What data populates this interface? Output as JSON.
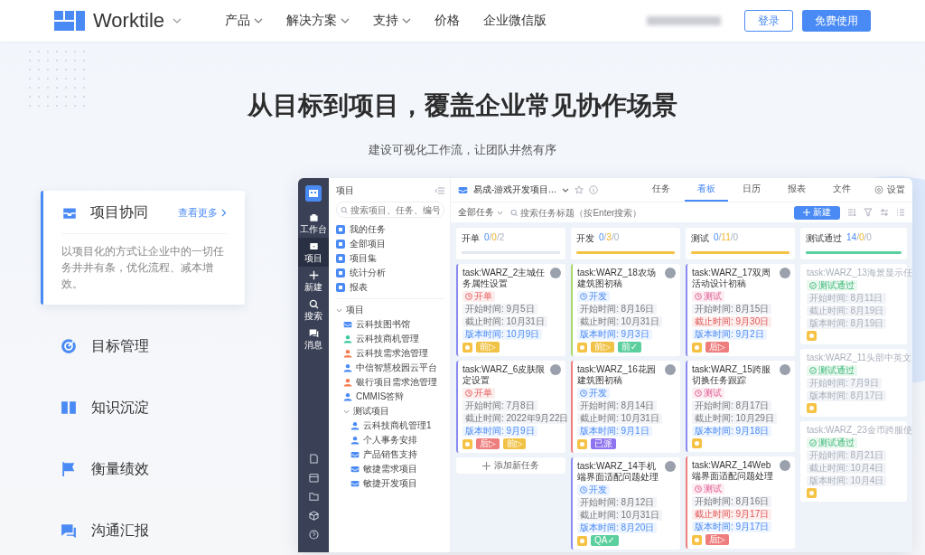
{
  "nav": {
    "logo": "Worktile",
    "items": [
      {
        "label": "产品",
        "dropdown": true
      },
      {
        "label": "解决方案",
        "dropdown": true
      },
      {
        "label": "支持",
        "dropdown": true
      },
      {
        "label": "价格",
        "dropdown": false
      },
      {
        "label": "企业微信版",
        "dropdown": false
      }
    ],
    "login": "登录",
    "signup": "免费使用"
  },
  "hero": {
    "title": "从目标到项目，覆盖企业常见协作场景",
    "subtitle": "建设可视化工作流，让团队井然有序"
  },
  "features": [
    {
      "title": "项目协同",
      "selected": true,
      "link": "查看更多",
      "description": "以项目化的方式让企业中的一切任务井井有条，优化流程、减本增效。"
    },
    {
      "title": "目标管理",
      "selected": false
    },
    {
      "title": "知识沉淀",
      "selected": false
    },
    {
      "title": "衡量绩效",
      "selected": false
    },
    {
      "title": "沟通汇报",
      "selected": false
    }
  ],
  "app": {
    "rail": [
      {
        "label": "工作台",
        "selected": false
      },
      {
        "label": "项目",
        "selected": true
      },
      {
        "label": "新建",
        "selected": false
      },
      {
        "label": "搜索",
        "selected": false
      },
      {
        "label": "消息",
        "selected": false
      }
    ],
    "sidebar": {
      "title": "项目",
      "search_placeholder": "搜索项目、任务、编号",
      "nav": [
        {
          "label": "我的任务"
        },
        {
          "label": "全部项目"
        },
        {
          "label": "项目集"
        },
        {
          "label": "统计分析"
        },
        {
          "label": "报表"
        }
      ],
      "tree": [
        {
          "label": "项目",
          "expanded": true,
          "children": [
            {
              "label": "云科技图书馆",
              "kind": "box",
              "color": "#4a8af4"
            },
            {
              "label": "云科技商机管理",
              "kind": "person",
              "color": "#3cc9a0"
            },
            {
              "label": "云科技需求池管理",
              "kind": "person",
              "color": "#f37b4f"
            },
            {
              "label": "中信智慧校园云平台",
              "kind": "person",
              "color": "#4a8af4"
            },
            {
              "label": "银行项目需求池管理",
              "kind": "person",
              "color": "#f37b4f"
            },
            {
              "label": "CMMIS答辩",
              "kind": "person",
              "color": "#4a8af4"
            },
            {
              "label": "测试项目",
              "expanded": true,
              "children": [
                {
                  "label": "云科技商机管理1",
                  "kind": "person",
                  "color": "#4a8af4"
                },
                {
                  "label": "个人事务安排",
                  "kind": "person",
                  "color": "#4a8af4"
                },
                {
                  "label": "产品销售支持",
                  "kind": "box",
                  "color": "#4a8af4"
                },
                {
                  "label": "敏捷需求项目",
                  "kind": "box",
                  "color": "#4a8af4"
                },
                {
                  "label": "敏捷开发项目",
                  "kind": "box",
                  "color": "#4a8af4"
                }
              ]
            }
          ]
        }
      ]
    },
    "header": {
      "project": "易成-游戏开发项目...",
      "tabs": [
        {
          "label": "任务",
          "selected": false
        },
        {
          "label": "看板",
          "selected": true
        },
        {
          "label": "日历",
          "selected": false
        },
        {
          "label": "报表",
          "selected": false
        },
        {
          "label": "文件",
          "selected": false
        }
      ],
      "settings": "设置"
    },
    "toolbar": {
      "filter": "全部任务",
      "search_placeholder": "搜索任务标题（按Enter搜索）",
      "new_button": "新建"
    },
    "columns": [
      {
        "title": "开单",
        "counts": [
          "0",
          "/",
          "0",
          "/",
          "2"
        ],
        "color": "#e3e8f0",
        "level": 1,
        "faded": false,
        "add": "添加新任务",
        "cards": [
          {
            "title": "task:WARZ_2主城任务属性设置",
            "color": "#8a8cf0",
            "status": {
              "label": "开单",
              "kind": "open"
            },
            "dates": [
              {
                "text": "开始时间: 9月5日",
                "kind": "plain"
              },
              {
                "text": "截止时间: 10月31日",
                "kind": "plain"
              },
              {
                "text": "版本时间: 10月9日",
                "kind": "version"
              }
            ],
            "priority": true,
            "tags": [
              {
                "text": "前▷",
                "color": "#f0c246"
              }
            ]
          },
          {
            "title": "task:WARZ_6皮肤限定设置",
            "color": "#8a8cf0",
            "status": {
              "label": "开单",
              "kind": "open"
            },
            "dates": [
              {
                "text": "开始时间: 7月8日",
                "kind": "plain"
              },
              {
                "text": "截止时间: 2022年9月22日",
                "kind": "plain"
              },
              {
                "text": "版本时间: 9月9日",
                "kind": "version"
              }
            ],
            "priority": true,
            "tags": [
              {
                "text": "后▷",
                "color": "#ee7d7d"
              },
              {
                "text": "前▷",
                "color": "#f0c246"
              }
            ]
          }
        ]
      },
      {
        "title": "开发",
        "counts": [
          "0",
          "/",
          "3",
          "/",
          "0"
        ],
        "color": "#f6c244",
        "level": 1,
        "faded": false,
        "cards": [
          {
            "title": "task:WARZ_18农场建筑图初稿",
            "color": "#a8d86a",
            "status": {
              "label": "开发",
              "kind": "dev"
            },
            "dates": [
              {
                "text": "开始时间: 8月16日",
                "kind": "plain"
              },
              {
                "text": "截止时间: 10月31日",
                "kind": "plain"
              },
              {
                "text": "版本时间: 9月3日",
                "kind": "version"
              }
            ],
            "priority": true,
            "tags": [
              {
                "text": "前▷",
                "color": "#f0c246"
              },
              {
                "text": "前✓",
                "color": "#5ccf9e"
              }
            ]
          },
          {
            "title": "task:WARZ_16花园建筑图初稿",
            "color": "#ee7d7d",
            "status": {
              "label": "开发",
              "kind": "dev"
            },
            "dates": [
              {
                "text": "开始时间: 8月14日",
                "kind": "plain"
              },
              {
                "text": "截止时间: 10月31日",
                "kind": "plain"
              },
              {
                "text": "版本时间: 9月1日",
                "kind": "version"
              }
            ],
            "priority": true,
            "tags": [
              {
                "text": "已派",
                "color": "#8f74f0"
              }
            ]
          },
          {
            "title": "task:WARZ_14手机端界面适配问题处理",
            "color": "#8a8cf0",
            "status": {
              "label": "开发",
              "kind": "dev"
            },
            "dates": [
              {
                "text": "开始时间: 8月12日",
                "kind": "plain"
              },
              {
                "text": "截止时间: 10月31日",
                "kind": "plain"
              },
              {
                "text": "版本时间: 8月20日",
                "kind": "version"
              }
            ],
            "priority": true,
            "tags": [
              {
                "text": "QA✓",
                "color": "#5ccf9e"
              }
            ]
          }
        ]
      },
      {
        "title": "测试",
        "counts": [
          "0",
          "/",
          "11",
          "/",
          "0"
        ],
        "color": "#f6c244",
        "level": 1,
        "faded": false,
        "cards": [
          {
            "title": "task:WARZ_17双周活动设计初稿",
            "color": "#8a8cf0",
            "status": {
              "label": "测试",
              "kind": "test"
            },
            "dates": [
              {
                "text": "开始时间: 8月15日",
                "kind": "plain"
              },
              {
                "text": "截止时间: 9月30日",
                "kind": "overdue"
              },
              {
                "text": "版本时间: 9月2日",
                "kind": "version"
              }
            ],
            "priority": true,
            "tags": [
              {
                "text": "后▷",
                "color": "#ee7d7d"
              }
            ]
          },
          {
            "title": "task:WARZ_15跨服切换任务跟踪",
            "color": "#8a8cf0",
            "status": {
              "label": "测试",
              "kind": "test"
            },
            "dates": [
              {
                "text": "开始时间: 8月17日",
                "kind": "plain"
              },
              {
                "text": "截止时间: 10月29日",
                "kind": "plain"
              },
              {
                "text": "版本时间: 9月18日",
                "kind": "version"
              }
            ],
            "priority": true
          },
          {
            "title": "task:WARZ_14Web端界面适配问题处理",
            "color": "#ee7d7d",
            "status": {
              "label": "测试",
              "kind": "test"
            },
            "dates": [
              {
                "text": "开始时间: 8月16日",
                "kind": "plain"
              },
              {
                "text": "截止时间: 9月17日",
                "kind": "overdue"
              },
              {
                "text": "版本时间: 9月17日",
                "kind": "version"
              }
            ],
            "priority": true,
            "tags": [
              {
                "text": "后▷",
                "color": "#ee7d7d"
              }
            ]
          }
        ]
      },
      {
        "title": "测试通过",
        "counts": [
          "14",
          "/",
          "0",
          "/",
          "0"
        ],
        "color": "#5ccf9e",
        "level": 1,
        "faded": true,
        "cards": [
          {
            "title": "task:WARZ_13海景显示任",
            "status": {
              "label": "测试通过",
              "kind": "passed"
            },
            "dates": [
              {
                "text": "开始时间: 8月11日",
                "kind": "plain"
              },
              {
                "text": "截止时间: 8月19日",
                "kind": "plain"
              },
              {
                "text": "版本时间: 8月19日",
                "kind": "plain"
              }
            ],
            "priority": true
          },
          {
            "title": "task:WARZ_11头部中英文",
            "status": {
              "label": "测试通过",
              "kind": "passed"
            },
            "dates": [
              {
                "text": "开始时间: 7月9日",
                "kind": "plain"
              },
              {
                "text": "版本时间: 8月17日",
                "kind": "plain"
              }
            ],
            "priority": true
          },
          {
            "title": "task:WARZ_23金币跨服使",
            "status": {
              "label": "测试通过",
              "kind": "passed"
            },
            "dates": [
              {
                "text": "开始时间: 8月21日",
                "kind": "plain"
              },
              {
                "text": "截止时间: 10月4日",
                "kind": "plain"
              },
              {
                "text": "版本时间: 10月4日",
                "kind": "plain"
              }
            ],
            "priority": true
          }
        ]
      }
    ]
  }
}
